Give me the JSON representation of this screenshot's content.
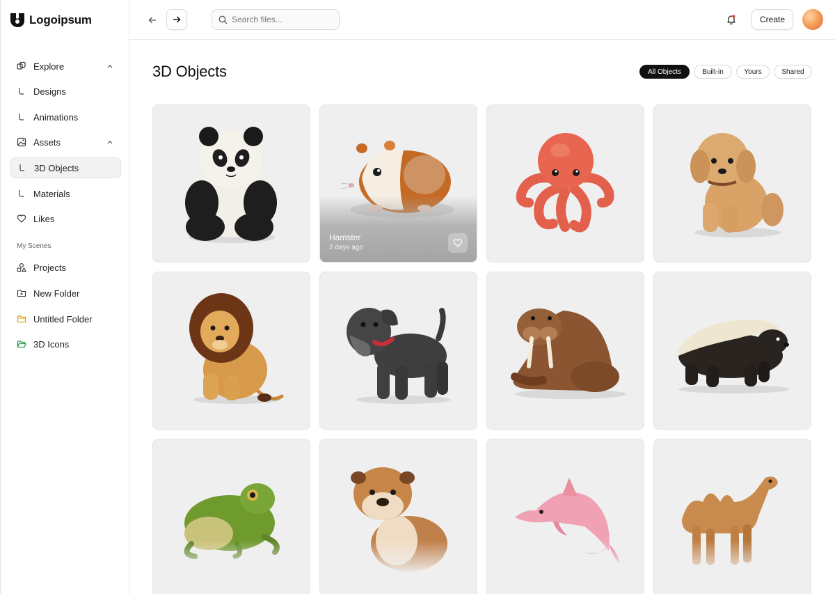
{
  "brand": {
    "name": "Logoipsum"
  },
  "sidebar": {
    "items": [
      {
        "label": "Explore",
        "icon": "explore-icon"
      },
      {
        "label": "Designs",
        "icon": "subitem-corner-icon"
      },
      {
        "label": "Animations",
        "icon": "subitem-corner-icon"
      },
      {
        "label": "Assets",
        "icon": "image-icon"
      },
      {
        "label": "3D Objects",
        "icon": "subitem-corner-icon",
        "active": true
      },
      {
        "label": "Materials",
        "icon": "subitem-corner-icon"
      },
      {
        "label": "Likes",
        "icon": "heart-icon"
      }
    ],
    "section_label": "My Scenes",
    "scenes": [
      {
        "label": "Projects",
        "icon": "shapes-icon"
      },
      {
        "label": "New Folder",
        "icon": "folder-plus-icon"
      },
      {
        "label": "Untitled Folder",
        "icon": "folder-icon",
        "color": "#e0a81c"
      },
      {
        "label": "3D Icons",
        "icon": "folder-open-icon",
        "color": "#2e9b4e"
      }
    ]
  },
  "topbar": {
    "search_placeholder": "Search files...",
    "create_label": "Create"
  },
  "main": {
    "title": "3D Objects",
    "filters": [
      "All Objects",
      "Built-in",
      "Yours",
      "Shared"
    ],
    "active_filter": "All Objects",
    "hover_card": {
      "name": "Hamster",
      "time": "2 days ago"
    },
    "cards": [
      "panda",
      "hamster",
      "octopus",
      "poodle",
      "lion",
      "schnauzer",
      "walrus",
      "honey-badger",
      "frog",
      "bulldog",
      "dolphin",
      "camel"
    ]
  },
  "colors": {
    "accent": "#111111",
    "card_bg": "#efefef"
  }
}
